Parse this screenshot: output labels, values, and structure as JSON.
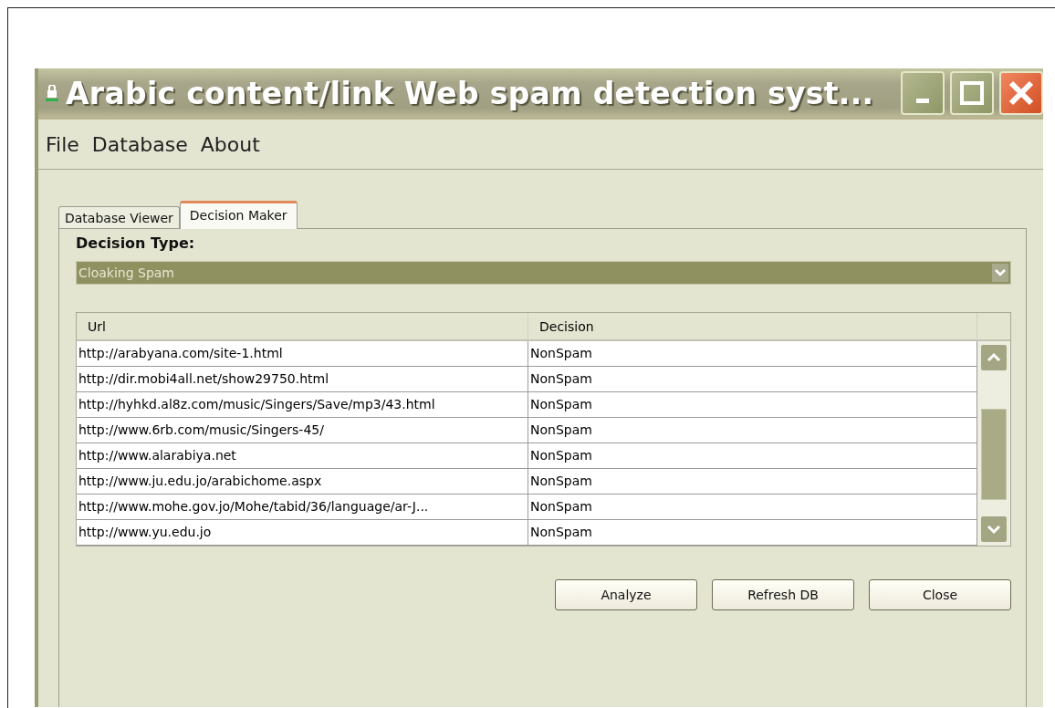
{
  "window": {
    "title": "Arabic content/link Web spam detection syst..."
  },
  "menu": [
    "File",
    "Database",
    "About"
  ],
  "tabs": [
    {
      "label": "Database Viewer",
      "selected": false
    },
    {
      "label": "Decision Maker",
      "selected": true
    }
  ],
  "decision_type": {
    "label": "Decision Type:",
    "value": "Cloaking Spam"
  },
  "table": {
    "columns": [
      "Url",
      "Decision"
    ],
    "rows": [
      [
        "http://arabyana.com/site-1.html",
        "NonSpam"
      ],
      [
        "http://dir.mobi4all.net/show29750.html",
        "NonSpam"
      ],
      [
        "http://hyhkd.al8z.com/music/Singers/Save/mp3/43.html",
        "NonSpam"
      ],
      [
        "http://www.6rb.com/music/Singers-45/",
        "NonSpam"
      ],
      [
        "http://www.alarabiya.net",
        "NonSpam"
      ],
      [
        "http://www.ju.edu.jo/arabichome.aspx",
        "NonSpam"
      ],
      [
        "http://www.mohe.gov.jo/Mohe/tabid/36/language/ar-J...",
        "NonSpam"
      ],
      [
        "http://www.yu.edu.jo",
        "NonSpam"
      ]
    ]
  },
  "buttons": [
    "Analyze",
    "Refresh DB",
    "Close"
  ]
}
